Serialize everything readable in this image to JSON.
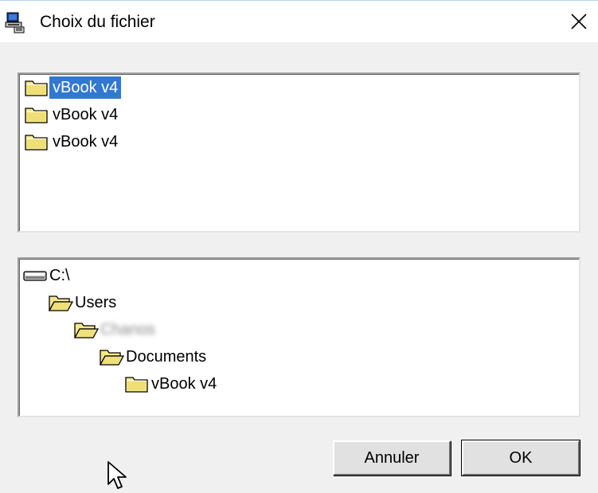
{
  "window": {
    "title": "Choix du fichier",
    "close_label": "✕"
  },
  "file_list": {
    "items": [
      {
        "label": "vBook v4",
        "selected": true
      },
      {
        "label": "vBook v4",
        "selected": false
      },
      {
        "label": "vBook v4",
        "selected": false
      }
    ]
  },
  "directory_tree": {
    "items": [
      {
        "label": "C:\\",
        "icon": "drive-icon"
      },
      {
        "label": "Users",
        "icon": "open-folder-icon"
      },
      {
        "label": "Chanos",
        "icon": "open-folder-icon"
      },
      {
        "label": "Documents",
        "icon": "open-folder-icon"
      },
      {
        "label": "vBook v4",
        "icon": "folder-icon"
      }
    ]
  },
  "buttons": {
    "cancel_label": "Annuler",
    "ok_label": "OK"
  },
  "colors": {
    "selection": "#3178d1",
    "folder_fill": "#f5e88a"
  }
}
